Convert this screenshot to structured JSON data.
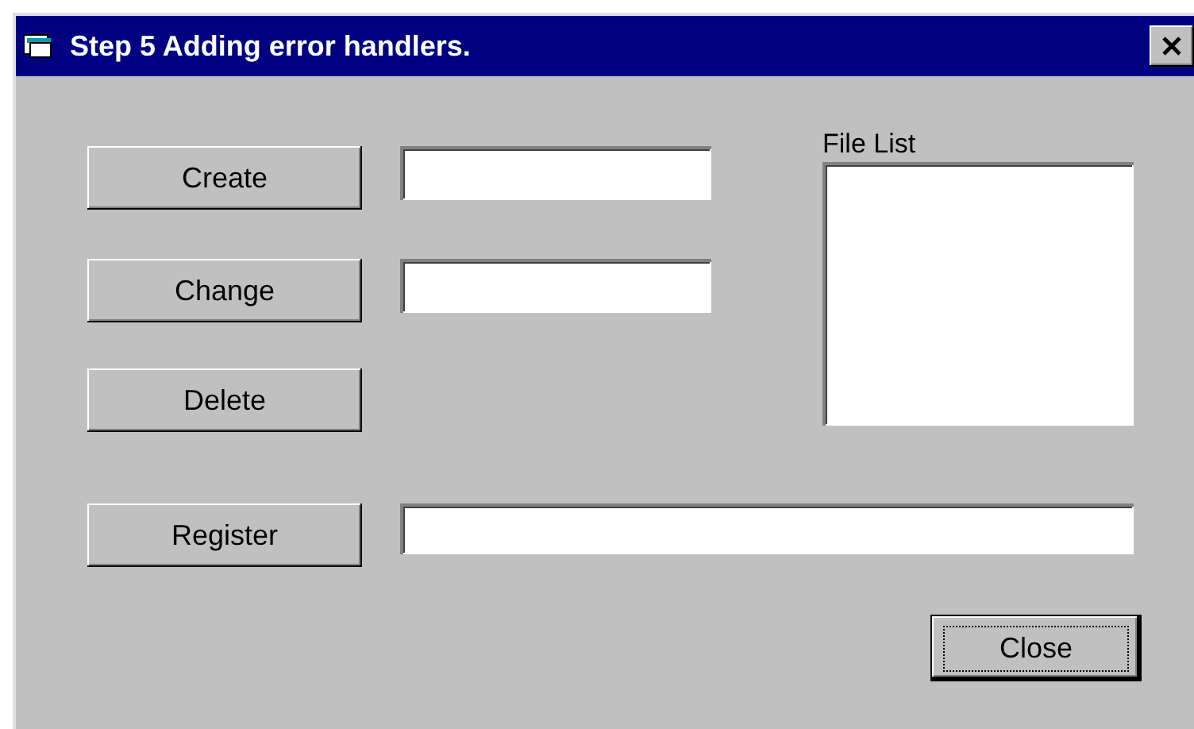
{
  "window": {
    "title": "Step 5 Adding error handlers."
  },
  "buttons": [
    {
      "label": "Create"
    },
    {
      "label": "Change"
    },
    {
      "label": "Delete"
    },
    {
      "label": "Register"
    }
  ],
  "file_list": {
    "label": "File List"
  },
  "close_button": {
    "label": "Close",
    "focused": true
  }
}
